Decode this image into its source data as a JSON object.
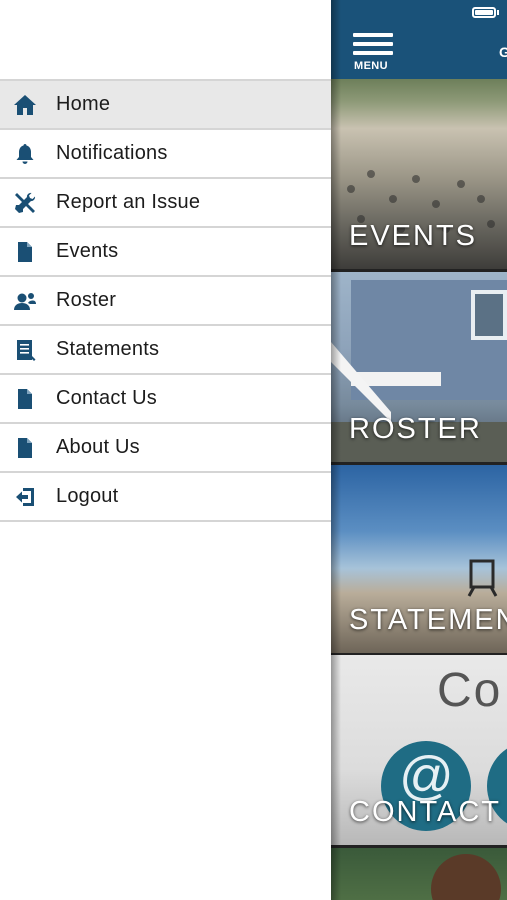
{
  "menu": {
    "items": [
      {
        "label": "Home",
        "icon": "home-icon",
        "active": true
      },
      {
        "label": "Notifications",
        "icon": "bell-icon"
      },
      {
        "label": "Report an Issue",
        "icon": "tools-icon"
      },
      {
        "label": "Events",
        "icon": "document-icon"
      },
      {
        "label": "Roster",
        "icon": "person-icon"
      },
      {
        "label": "Statements",
        "icon": "statement-icon"
      },
      {
        "label": "Contact Us",
        "icon": "document-icon"
      },
      {
        "label": "About Us",
        "icon": "document-icon"
      },
      {
        "label": "Logout",
        "icon": "logout-icon"
      }
    ]
  },
  "topbar": {
    "menu_label": "MENU",
    "title_partial": "G"
  },
  "tiles": {
    "events": "EVENTS",
    "roster": "ROSTER",
    "statements": "STATEMEN",
    "contact": "CONTACT",
    "contact_header": "Co",
    "contact_symbol": "@"
  },
  "colors": {
    "brand": "#1a5279",
    "icon": "#1a4f74",
    "active_row": "#e8e8e8"
  }
}
